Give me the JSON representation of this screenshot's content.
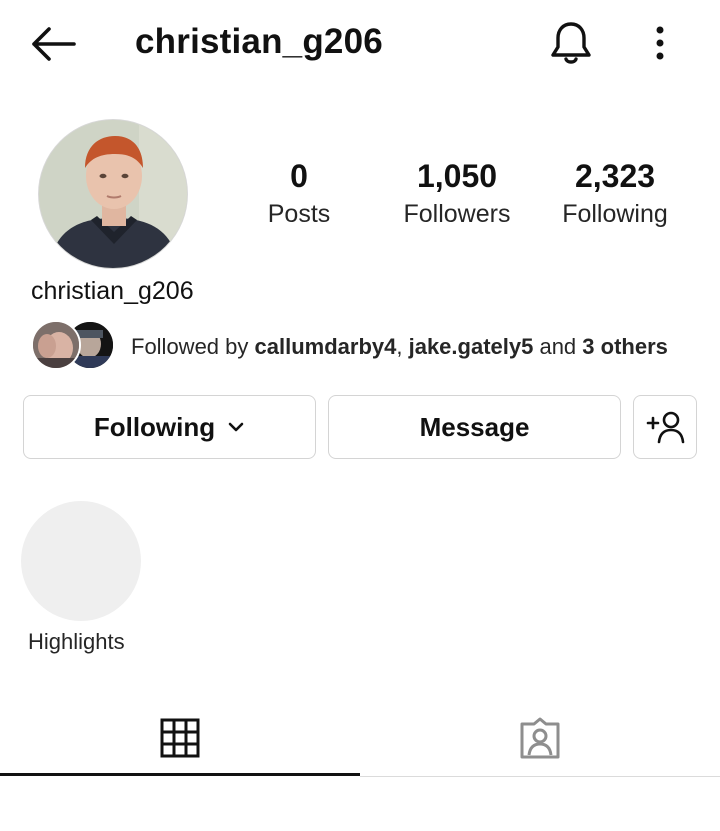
{
  "header": {
    "username": "christian_g206",
    "back_icon": "arrow-left-icon",
    "notification_icon": "bell-icon",
    "more_icon": "more-vertical-icon"
  },
  "profile": {
    "name": "christian_g206",
    "stats": {
      "posts": {
        "value": "0",
        "label": "Posts"
      },
      "followers": {
        "value": "1,050",
        "label": "Followers"
      },
      "following": {
        "value": "2,323",
        "label": "Following"
      }
    }
  },
  "mutuals": {
    "prefix": "Followed by ",
    "user1": "callumdarby4",
    "separator": ", ",
    "user2": "jake.gately5",
    "conjunction": " and ",
    "others": "3 others"
  },
  "actions": {
    "following_label": "Following",
    "message_label": "Message",
    "add_user_icon": "add-user-icon"
  },
  "highlights": {
    "label": "Highlights"
  },
  "tabs": {
    "posts_icon": "grid-icon",
    "tagged_icon": "tagged-user-icon",
    "active": "posts"
  },
  "colors": {
    "text": "#262626",
    "border": "#d4d4d4",
    "highlight_bg": "#efefef",
    "tagged_icon": "#8e8e8e"
  }
}
